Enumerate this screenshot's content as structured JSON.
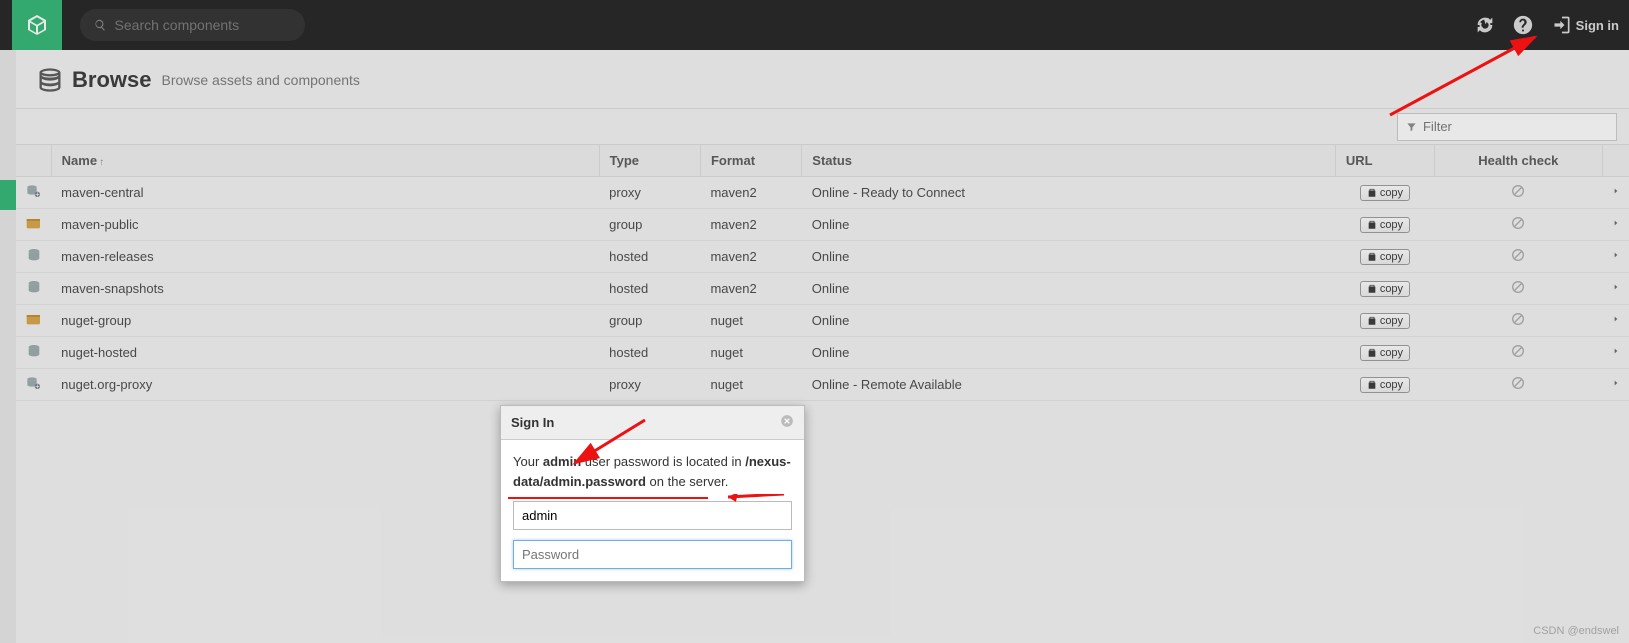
{
  "nav": {
    "search_placeholder": "Search components",
    "signin_label": "Sign in"
  },
  "page": {
    "title": "Browse",
    "subtitle": "Browse assets and components"
  },
  "filter": {
    "placeholder": "Filter"
  },
  "columns": {
    "name": "Name",
    "type": "Type",
    "format": "Format",
    "status": "Status",
    "url": "URL",
    "health": "Health check"
  },
  "copy_label": "copy",
  "rows": [
    {
      "icon": "proxy",
      "name": "maven-central",
      "type": "proxy",
      "format": "maven2",
      "status": "Online - Ready to Connect"
    },
    {
      "icon": "group",
      "name": "maven-public",
      "type": "group",
      "format": "maven2",
      "status": "Online"
    },
    {
      "icon": "hosted",
      "name": "maven-releases",
      "type": "hosted",
      "format": "maven2",
      "status": "Online"
    },
    {
      "icon": "hosted",
      "name": "maven-snapshots",
      "type": "hosted",
      "format": "maven2",
      "status": "Online"
    },
    {
      "icon": "group",
      "name": "nuget-group",
      "type": "group",
      "format": "nuget",
      "status": "Online"
    },
    {
      "icon": "hosted",
      "name": "nuget-hosted",
      "type": "hosted",
      "format": "nuget",
      "status": "Online"
    },
    {
      "icon": "proxy",
      "name": "nuget.org-proxy",
      "type": "proxy",
      "format": "nuget",
      "status": "Online - Remote Available"
    }
  ],
  "modal": {
    "title": "Sign In",
    "hint_pre": "Your ",
    "hint_bold1": "admin",
    "hint_mid": " user password is located in ",
    "hint_path": "/nexus-data/admin.password",
    "hint_post": " on the server.",
    "username_value": "admin",
    "password_placeholder": "Password"
  },
  "watermark": "CSDN @endswel"
}
